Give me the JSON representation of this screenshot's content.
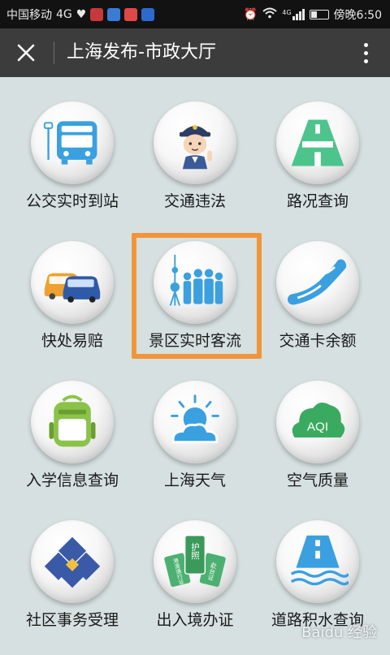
{
  "status_bar": {
    "carrier": "中国移动",
    "network": "4G",
    "network_small": "4G",
    "time": "傍晚6:50"
  },
  "header": {
    "title": "上海发布-市政大厅"
  },
  "services": [
    {
      "label": "公交实时到站",
      "icon": "bus-icon"
    },
    {
      "label": "交通违法",
      "icon": "traffic-police-icon"
    },
    {
      "label": "路况查询",
      "icon": "road-icon"
    },
    {
      "label": "快处易赔",
      "icon": "cars-icon"
    },
    {
      "label": "景区实时客流",
      "icon": "tower-crowd-icon"
    },
    {
      "label": "交通卡余额",
      "icon": "transport-card-icon"
    },
    {
      "label": "入学信息查询",
      "icon": "backpack-icon"
    },
    {
      "label": "上海天气",
      "icon": "weather-icon"
    },
    {
      "label": "空气质量",
      "icon": "aqi-cloud-icon"
    },
    {
      "label": "社区事务受理",
      "icon": "community-icon"
    },
    {
      "label": "出入境办证",
      "icon": "passport-cards-icon"
    },
    {
      "label": "道路积水查询",
      "icon": "waterlogging-icon"
    }
  ],
  "icon_text": {
    "aqi": "AQI",
    "passport": "护照",
    "permit_hk": "港澳通行证",
    "permit_tw": "赴台证"
  },
  "watermark": "Baidu 经验",
  "colors": {
    "highlight": "#f0953a",
    "header_bg": "#3c3c3c",
    "page_bg": "#d6e0e0",
    "icon_blue": "#3aa0e0",
    "icon_green": "#4cc48c"
  }
}
